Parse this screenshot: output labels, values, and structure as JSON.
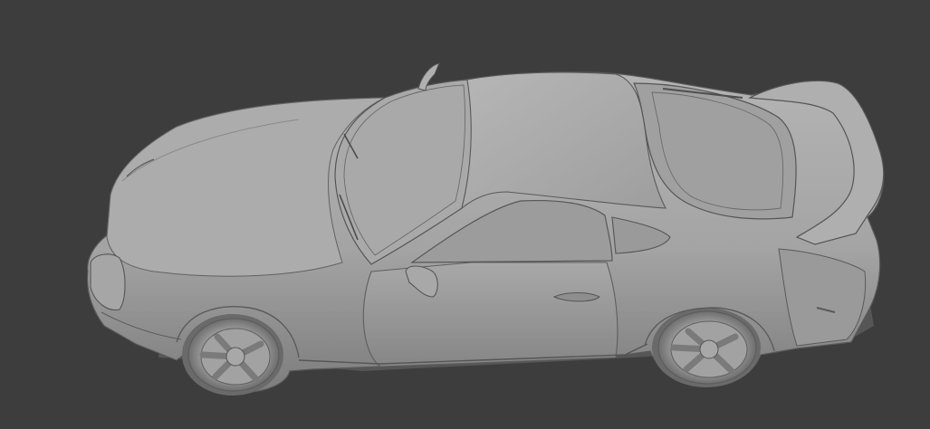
{
  "viewport": {
    "background_color": "#3d3d3d",
    "object": "sports-car-model",
    "shading": "solid-clay",
    "body_color": "#a4a4a4",
    "shadow_color": "#7a7a7a",
    "highlight_color": "#bdbdbd",
    "edge_color": "#4e4e4e"
  }
}
